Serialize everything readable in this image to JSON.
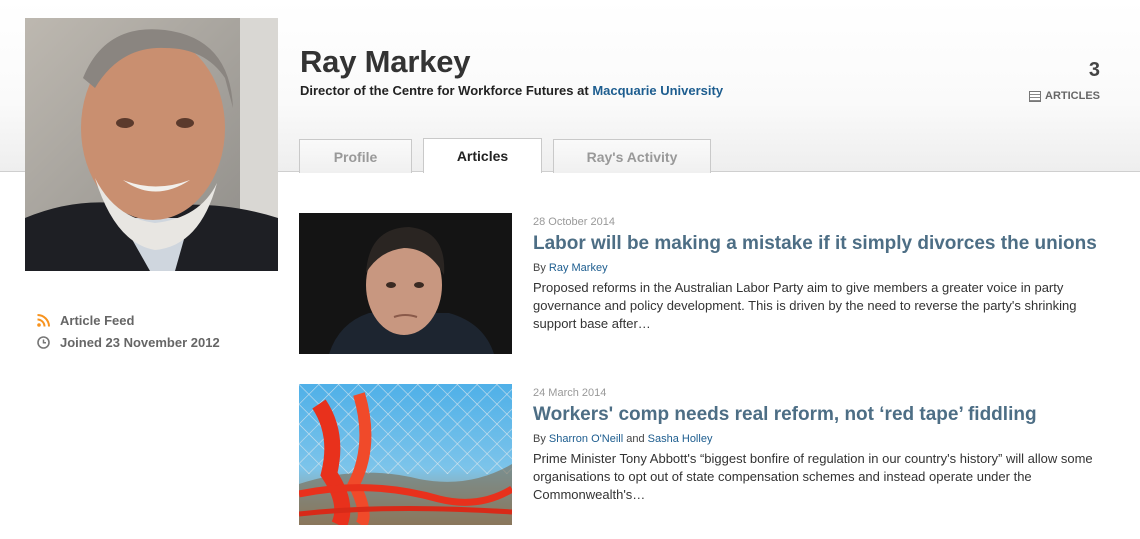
{
  "author": {
    "name": "Ray Markey",
    "role_prefix": "Director of the Centre for Workforce Futures at ",
    "institution": "Macquarie University",
    "article_count": "3",
    "article_count_label": "ARTICLES"
  },
  "tabs": [
    {
      "label": "Profile",
      "active": false
    },
    {
      "label": "Articles",
      "active": true
    },
    {
      "label": "Ray's Activity",
      "active": false
    }
  ],
  "sidebar": {
    "feed_label": "Article Feed",
    "feed_icon": "rss-icon",
    "joined_label": "Joined 23 November 2012",
    "joined_icon": "clock-icon"
  },
  "articles": [
    {
      "date": "28 October 2014",
      "title": "Labor will be making a mistake if it simply divorces the unions",
      "by": "By ",
      "authors": [
        "Ray Markey"
      ],
      "summary": "Proposed reforms in the Australian Labor Party aim to give members a greater voice in party governance and policy development. This is driven by the need to reverse the party's shrinking support base after…"
    },
    {
      "date": "24 March 2014",
      "title": "Workers' comp needs real reform, not ‘red tape’ fiddling",
      "by": "By ",
      "authors": [
        "Sharron O'Neill",
        "Sasha Holley"
      ],
      "and": " and ",
      "summary": "Prime Minister Tony Abbott's “biggest bonfire of regulation in our country's history” will allow some organisations to opt out of state compensation schemes and instead operate under the Commonwealth's…"
    }
  ],
  "colors": {
    "link": "#1d5d8f",
    "title": "#4d6e85",
    "rss": "#f7931e"
  }
}
